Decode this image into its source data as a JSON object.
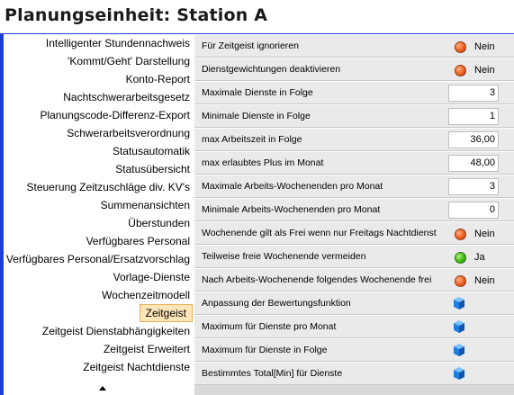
{
  "page_title": "Planungseinheit: Station A",
  "sidebar": {
    "items": [
      {
        "label": "Intelligenter Stundennachweis"
      },
      {
        "label": "'Kommt/Geht' Darstellung"
      },
      {
        "label": "Konto-Report"
      },
      {
        "label": "Nachtschwerarbeitsgesetz"
      },
      {
        "label": "Planungscode-Differenz-Export"
      },
      {
        "label": "Schwerarbeitsverordnung"
      },
      {
        "label": "Statusautomatik"
      },
      {
        "label": "Statusübersicht"
      },
      {
        "label": "Steuerung Zeitzuschläge div. KV's"
      },
      {
        "label": "Summenansichten"
      },
      {
        "label": "Überstunden"
      },
      {
        "label": "Verfügbares Personal"
      },
      {
        "label": "Verfügbares Personal/Ersatzvorschlag"
      },
      {
        "label": "Vorlage-Dienste"
      },
      {
        "label": "Wochenzeitmodell"
      },
      {
        "label": "Zeitgeist"
      },
      {
        "label": "Zeitgeist Dienstabhängigkeiten"
      },
      {
        "label": "Zeitgeist Erweitert"
      },
      {
        "label": "Zeitgeist Nachtdienste"
      }
    ],
    "selected": "Zeitgeist"
  },
  "settings": {
    "rows": [
      {
        "label": "Für Zeitgeist ignorieren",
        "kind": "flag",
        "state": "red",
        "value": "Nein"
      },
      {
        "label": "Dienstgewichtungen deaktivieren",
        "kind": "flag",
        "state": "red",
        "value": "Nein"
      },
      {
        "label": "Maximale Dienste in Folge",
        "kind": "number",
        "value": "3"
      },
      {
        "label": "Minimale Dienste in Folge",
        "kind": "number",
        "value": "1"
      },
      {
        "label": "max Arbeitszeit in Folge",
        "kind": "number",
        "value": "36,00"
      },
      {
        "label": "max erlaubtes Plus im Monat",
        "kind": "number",
        "value": "48,00"
      },
      {
        "label": "Maximale Arbeits-Wochenenden pro Monat",
        "kind": "number",
        "value": "3"
      },
      {
        "label": "Minimale Arbeits-Wochenenden pro Monat",
        "kind": "number",
        "value": "0"
      },
      {
        "label": "Wochenende gilt als Frei wenn nur Freitags Nachtdienst",
        "kind": "flag",
        "state": "red",
        "value": "Nein"
      },
      {
        "label": "Teilweise freie Wochenende vermeiden",
        "kind": "flag",
        "state": "green",
        "value": "Ja"
      },
      {
        "label": "Nach Arbeits-Wochenende folgendes Wochenende frei",
        "kind": "flag",
        "state": "red",
        "value": "Nein"
      },
      {
        "label": "Anpassung der Bewertungsfunktion",
        "kind": "cube"
      },
      {
        "label": "Maximum für Dienste pro Monat",
        "kind": "cube"
      },
      {
        "label": "Maximum für Dienste in Folge",
        "kind": "cube"
      },
      {
        "label": "Bestimmtes Total[Min] für Dienste",
        "kind": "cube"
      }
    ]
  },
  "icons": {
    "flag_off": "red-status-dot-icon",
    "flag_on": "green-status-dot-icon",
    "expand": "blue-cube-icon",
    "scroll": "scroll-up-arrow-icon"
  },
  "colors": {
    "accent_border": "#1e3fd6",
    "selected_bg": "#ffe6b8",
    "row_bg": "#eaeaea",
    "red": "#f06a2a",
    "green": "#4cc620",
    "cube": "#1f7fe0"
  }
}
